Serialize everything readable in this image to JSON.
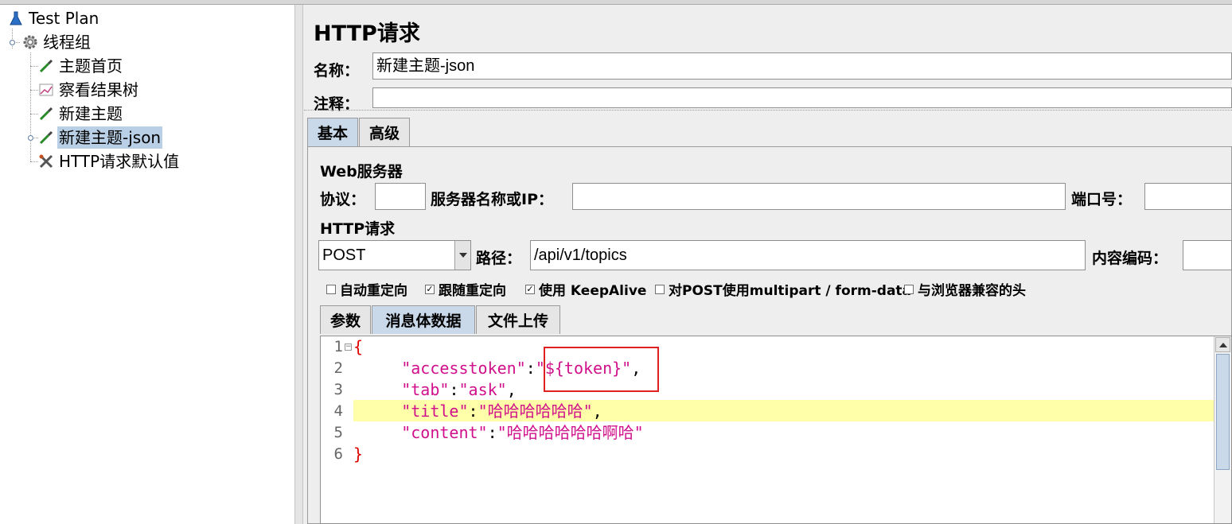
{
  "tree": {
    "items": [
      {
        "label": "Test Plan",
        "icon": "flask-icon"
      },
      {
        "label": "线程组",
        "icon": "gear-icon"
      },
      {
        "label": "主题首页",
        "icon": "pipette-icon"
      },
      {
        "label": "察看结果树",
        "icon": "chart-icon"
      },
      {
        "label": "新建主题",
        "icon": "pipette-icon"
      },
      {
        "label": "新建主题-json",
        "icon": "pipette-icon",
        "selected": true
      },
      {
        "label": "HTTP请求默认值",
        "icon": "wrench-icon"
      }
    ]
  },
  "panel": {
    "title": "HTTP请求",
    "name_label": "名称：",
    "name_value": "新建主题-json",
    "comment_label": "注释：",
    "comment_value": "",
    "tabs": [
      "基本",
      "高级"
    ],
    "web_server": {
      "title": "Web服务器",
      "protocol_label": "协议：",
      "protocol_value": "",
      "server_label": "服务器名称或IP：",
      "server_value": "",
      "port_label": "端口号：",
      "port_value": ""
    },
    "http_request": {
      "title": "HTTP请求",
      "method": "POST",
      "path_label": "路径：",
      "path_value": "/api/v1/topics",
      "encoding_label": "内容编码：",
      "encoding_value": ""
    },
    "options": [
      {
        "label": "自动重定向",
        "checked": false
      },
      {
        "label": "跟随重定向",
        "checked": true
      },
      {
        "label": "使用 KeepAlive",
        "checked": true
      },
      {
        "label": "对POST使用multipart / form-data",
        "checked": false
      },
      {
        "label": "与浏览器兼容的头",
        "checked": false
      }
    ],
    "body_tabs": [
      "参数",
      "消息体数据",
      "文件上传"
    ],
    "line_numbers": [
      "1",
      "2",
      "3",
      "4",
      "5",
      "6"
    ],
    "code": {
      "open": "{",
      "l2_key": "\"accesstoken\"",
      "l2_val": "\"${token}\"",
      "l3_key": "\"tab\"",
      "l3_val": "\"ask\"",
      "l4_key": "\"title\"",
      "l4_val": "\"哈哈哈哈哈哈\"",
      "l5_key": "\"content\"",
      "l5_val": "\"哈哈哈哈哈哈啊哈\"",
      "close": "}",
      "colon": ":",
      "comma": ","
    }
  },
  "colors": {
    "selection": "#b8cfe5",
    "current_line": "#ffffaa",
    "json_string": "#d0108a",
    "brace": "#e00000",
    "annotation_box": "#e02020"
  }
}
